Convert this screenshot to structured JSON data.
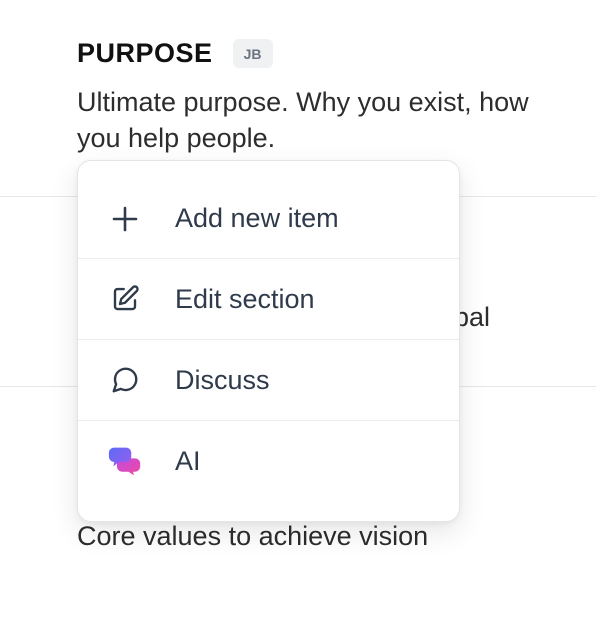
{
  "section": {
    "title": "PURPOSE",
    "badge": "JB",
    "description": "Ultimate purpose. Why you exist, how you help people."
  },
  "background": {
    "partial_text_right": "bal",
    "values_description": "Core values to achieve vision"
  },
  "menu": {
    "items": [
      {
        "label": "Add new item",
        "icon": "plus-icon"
      },
      {
        "label": "Edit section",
        "icon": "edit-icon"
      },
      {
        "label": "Discuss",
        "icon": "chat-bubble-icon"
      },
      {
        "label": "AI",
        "icon": "ai-chat-icon"
      }
    ]
  },
  "colors": {
    "text": "#2d2d2d",
    "menu_text": "#2f3a4a",
    "ai_gradient_start": "#6b6ef5",
    "ai_gradient_end": "#e044a8"
  }
}
